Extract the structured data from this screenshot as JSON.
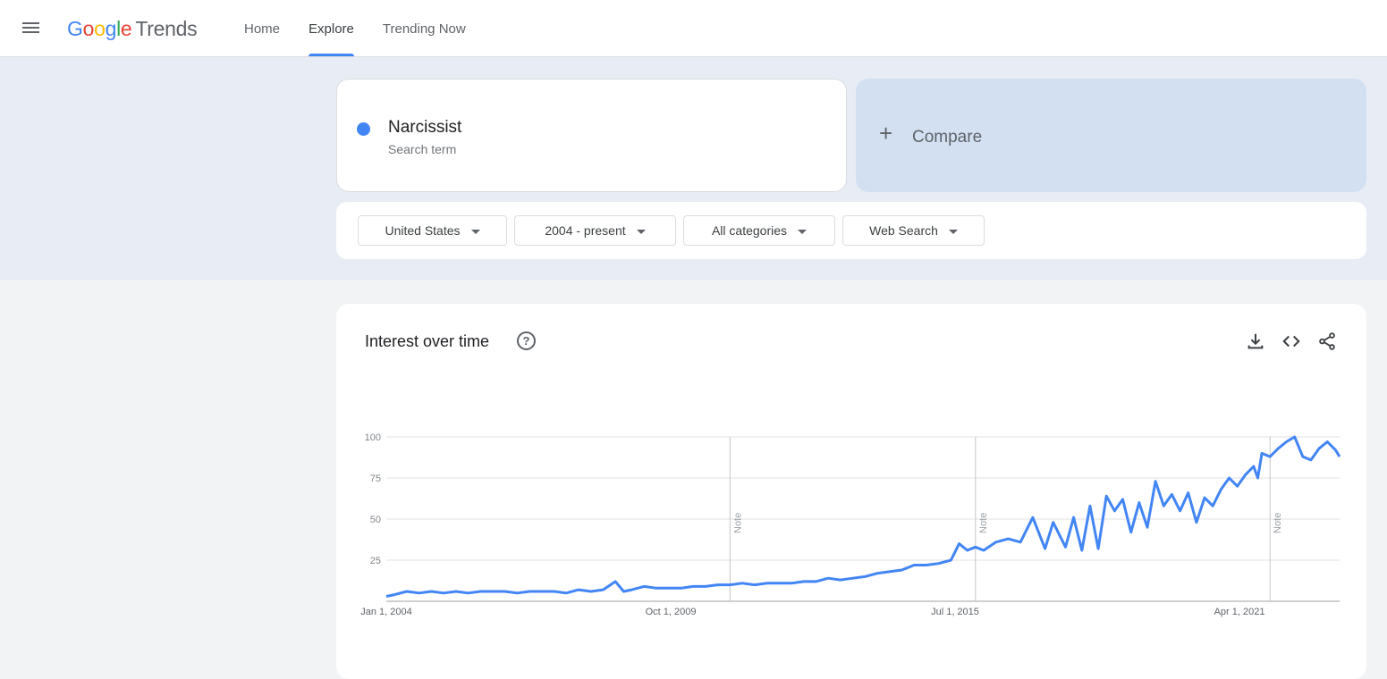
{
  "header": {
    "logo_google": "Google",
    "logo_trends": "Trends",
    "nav": [
      {
        "label": "Home",
        "active": false
      },
      {
        "label": "Explore",
        "active": true
      },
      {
        "label": "Trending Now",
        "active": false
      }
    ]
  },
  "search": {
    "term": "Narcissist",
    "term_subtitle": "Search term",
    "term_color": "#4285f4",
    "compare_label": "Compare"
  },
  "filters": {
    "region": "United States",
    "time_range": "2004 - present",
    "category": "All categories",
    "search_type": "Web Search"
  },
  "chart_panel": {
    "title": "Interest over time",
    "icons": [
      "help-icon",
      "download-icon",
      "embed-icon",
      "share-icon"
    ]
  },
  "chart_data": {
    "type": "line",
    "title": "Interest over time",
    "x_labels": [
      "Jan 1, 2004",
      "Oct 1, 2009",
      "Jul 1, 2015",
      "Apr 1, 2021"
    ],
    "y_ticks": [
      25,
      50,
      75,
      100
    ],
    "ylim": [
      0,
      100
    ],
    "x_range": [
      "2004-01",
      "2023-06"
    ],
    "grid": true,
    "notes": [
      {
        "label": "Note",
        "date": "2011-01"
      },
      {
        "label": "Note",
        "date": "2016-01"
      },
      {
        "label": "Note",
        "date": "2022-01"
      }
    ],
    "series": [
      {
        "name": "Narcissist",
        "color": "#4285f4",
        "points": [
          [
            "2004-01",
            3
          ],
          [
            "2004-03",
            4
          ],
          [
            "2004-06",
            6
          ],
          [
            "2004-09",
            5
          ],
          [
            "2004-12",
            6
          ],
          [
            "2005-03",
            5
          ],
          [
            "2005-06",
            6
          ],
          [
            "2005-09",
            5
          ],
          [
            "2005-12",
            6
          ],
          [
            "2006-03",
            6
          ],
          [
            "2006-06",
            6
          ],
          [
            "2006-09",
            5
          ],
          [
            "2006-12",
            6
          ],
          [
            "2007-03",
            6
          ],
          [
            "2007-06",
            6
          ],
          [
            "2007-09",
            5
          ],
          [
            "2007-12",
            7
          ],
          [
            "2008-03",
            6
          ],
          [
            "2008-06",
            7
          ],
          [
            "2008-09",
            12
          ],
          [
            "2008-11",
            6
          ],
          [
            "2009-01",
            7
          ],
          [
            "2009-04",
            9
          ],
          [
            "2009-07",
            8
          ],
          [
            "2009-10",
            8
          ],
          [
            "2010-01",
            8
          ],
          [
            "2010-04",
            9
          ],
          [
            "2010-07",
            9
          ],
          [
            "2010-10",
            10
          ],
          [
            "2011-01",
            10
          ],
          [
            "2011-04",
            11
          ],
          [
            "2011-07",
            10
          ],
          [
            "2011-10",
            11
          ],
          [
            "2012-01",
            11
          ],
          [
            "2012-04",
            11
          ],
          [
            "2012-07",
            12
          ],
          [
            "2012-10",
            12
          ],
          [
            "2013-01",
            14
          ],
          [
            "2013-04",
            13
          ],
          [
            "2013-07",
            14
          ],
          [
            "2013-10",
            15
          ],
          [
            "2014-01",
            17
          ],
          [
            "2014-04",
            18
          ],
          [
            "2014-07",
            19
          ],
          [
            "2014-10",
            22
          ],
          [
            "2015-01",
            22
          ],
          [
            "2015-04",
            23
          ],
          [
            "2015-07",
            25
          ],
          [
            "2015-09",
            35
          ],
          [
            "2015-11",
            31
          ],
          [
            "2016-01",
            33
          ],
          [
            "2016-03",
            31
          ],
          [
            "2016-06",
            36
          ],
          [
            "2016-09",
            38
          ],
          [
            "2016-12",
            36
          ],
          [
            "2017-03",
            51
          ],
          [
            "2017-06",
            32
          ],
          [
            "2017-08",
            48
          ],
          [
            "2017-11",
            33
          ],
          [
            "2018-01",
            51
          ],
          [
            "2018-03",
            31
          ],
          [
            "2018-05",
            58
          ],
          [
            "2018-07",
            32
          ],
          [
            "2018-09",
            64
          ],
          [
            "2018-11",
            55
          ],
          [
            "2019-01",
            62
          ],
          [
            "2019-03",
            42
          ],
          [
            "2019-05",
            60
          ],
          [
            "2019-07",
            45
          ],
          [
            "2019-09",
            73
          ],
          [
            "2019-11",
            58
          ],
          [
            "2020-01",
            65
          ],
          [
            "2020-03",
            55
          ],
          [
            "2020-05",
            66
          ],
          [
            "2020-07",
            48
          ],
          [
            "2020-09",
            63
          ],
          [
            "2020-11",
            58
          ],
          [
            "2021-01",
            68
          ],
          [
            "2021-03",
            75
          ],
          [
            "2021-05",
            70
          ],
          [
            "2021-07",
            77
          ],
          [
            "2021-09",
            82
          ],
          [
            "2021-10",
            75
          ],
          [
            "2021-11",
            90
          ],
          [
            "2022-01",
            88
          ],
          [
            "2022-03",
            93
          ],
          [
            "2022-05",
            97
          ],
          [
            "2022-07",
            100
          ],
          [
            "2022-09",
            88
          ],
          [
            "2022-11",
            86
          ],
          [
            "2023-01",
            93
          ],
          [
            "2023-03",
            97
          ],
          [
            "2023-05",
            92
          ],
          [
            "2023-06",
            88
          ]
        ]
      }
    ]
  }
}
